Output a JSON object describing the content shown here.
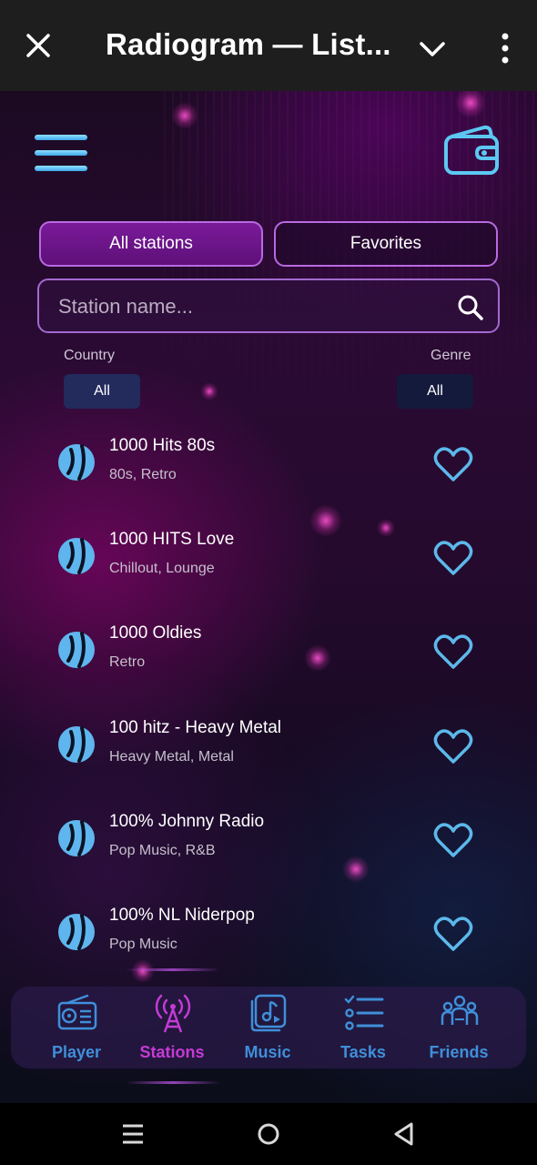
{
  "window": {
    "title": "Radiogram — List..."
  },
  "tabs": [
    {
      "label": "All stations",
      "active": true
    },
    {
      "label": "Favorites",
      "active": false
    }
  ],
  "search": {
    "placeholder": "Station name..."
  },
  "filters": {
    "country": {
      "label": "Country",
      "value": "All"
    },
    "genre": {
      "label": "Genre",
      "value": "All"
    }
  },
  "stations": [
    {
      "name": "1000 Hits 80s",
      "genres": "80s, Retro"
    },
    {
      "name": "1000 HITS Love",
      "genres": "Chillout, Lounge"
    },
    {
      "name": "1000 Oldies",
      "genres": "Retro"
    },
    {
      "name": "100 hitz - Heavy Metal",
      "genres": "Heavy Metal, Metal"
    },
    {
      "name": "100% Johnny Radio",
      "genres": "Pop Music, R&B"
    },
    {
      "name": "100% NL Niderpop",
      "genres": "Pop Music"
    }
  ],
  "bottom_nav": [
    {
      "label": "Player",
      "icon": "radio-icon",
      "active": false
    },
    {
      "label": "Stations",
      "icon": "antenna-icon",
      "active": true
    },
    {
      "label": "Music",
      "icon": "music-library-icon",
      "active": false
    },
    {
      "label": "Tasks",
      "icon": "checklist-icon",
      "active": false
    },
    {
      "label": "Friends",
      "icon": "group-icon",
      "active": false
    }
  ],
  "colors": {
    "accent_blue": "#3f8fd9",
    "accent_magenta": "#c43bd5",
    "tab_active": "#6e1690",
    "heart": "#5cb8ea"
  }
}
